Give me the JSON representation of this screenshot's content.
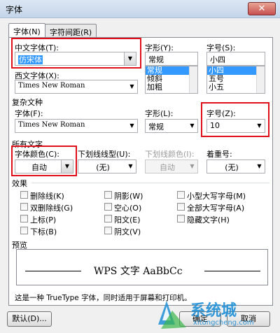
{
  "window": {
    "title": "字体",
    "close_glyph": "✕"
  },
  "tabs": [
    {
      "label": "字体(N)",
      "active": true
    },
    {
      "label": "字符间距(R)",
      "active": false
    }
  ],
  "chinese_font": {
    "label": "中文字体(T):",
    "value": "仿宋体"
  },
  "style": {
    "label": "字形(Y):",
    "value": "常规",
    "options": [
      "常规",
      "倾斜",
      "加粗"
    ]
  },
  "size": {
    "label": "字号(S):",
    "value": "小四",
    "options": [
      "小四",
      "五号",
      "小五"
    ]
  },
  "western_font": {
    "label": "西文字体(X):",
    "value": "Times New Roman"
  },
  "complex": {
    "section_label": "复杂文种",
    "font_label": "字体(F):",
    "font_value": "Times New Roman",
    "style_label": "字形(L):",
    "style_value": "常规",
    "size_label": "字号(Z):",
    "size_value": "10"
  },
  "all_text": {
    "section_label": "所有文字",
    "color_label": "字体颜色(C):",
    "color_value": "自动",
    "underline_label": "下划线线型(U):",
    "underline_value": "(无)",
    "underline_color_label": "下划线颜色(I):",
    "underline_color_value": "自动",
    "emphasis_label": "着重号:",
    "emphasis_value": "(无)"
  },
  "effects": {
    "section_label": "效果",
    "items": [
      {
        "label": "删除线(K)"
      },
      {
        "label": "双删除线(G)"
      },
      {
        "label": "上标(P)"
      },
      {
        "label": "下标(B)"
      },
      {
        "label": "阴影(W)"
      },
      {
        "label": "空心(O)"
      },
      {
        "label": "阳文(E)"
      },
      {
        "label": "阴文(V)"
      },
      {
        "label": "小型大写字母(M)"
      },
      {
        "label": "全部大写字母(A)"
      },
      {
        "label": "隐藏文字(H)"
      }
    ]
  },
  "preview": {
    "section_label": "预览",
    "sample_text": "WPS 文字 AaBbCc"
  },
  "info_text": "这是一种 TrueType 字体，同时适用于屏幕和打印机。",
  "buttons": {
    "default_label": "默认(D)...",
    "ok_label": "确定",
    "cancel_label": "取消"
  },
  "watermark": {
    "text": "系统城",
    "url": "xitongcheng.com"
  },
  "colors": {
    "highlight": "#e0101a",
    "selection": "#3399ff",
    "watermark": "#1e8fd6"
  },
  "icons": [
    "close-icon",
    "dropdown-arrow-icon",
    "watermark-logo-icon"
  ]
}
